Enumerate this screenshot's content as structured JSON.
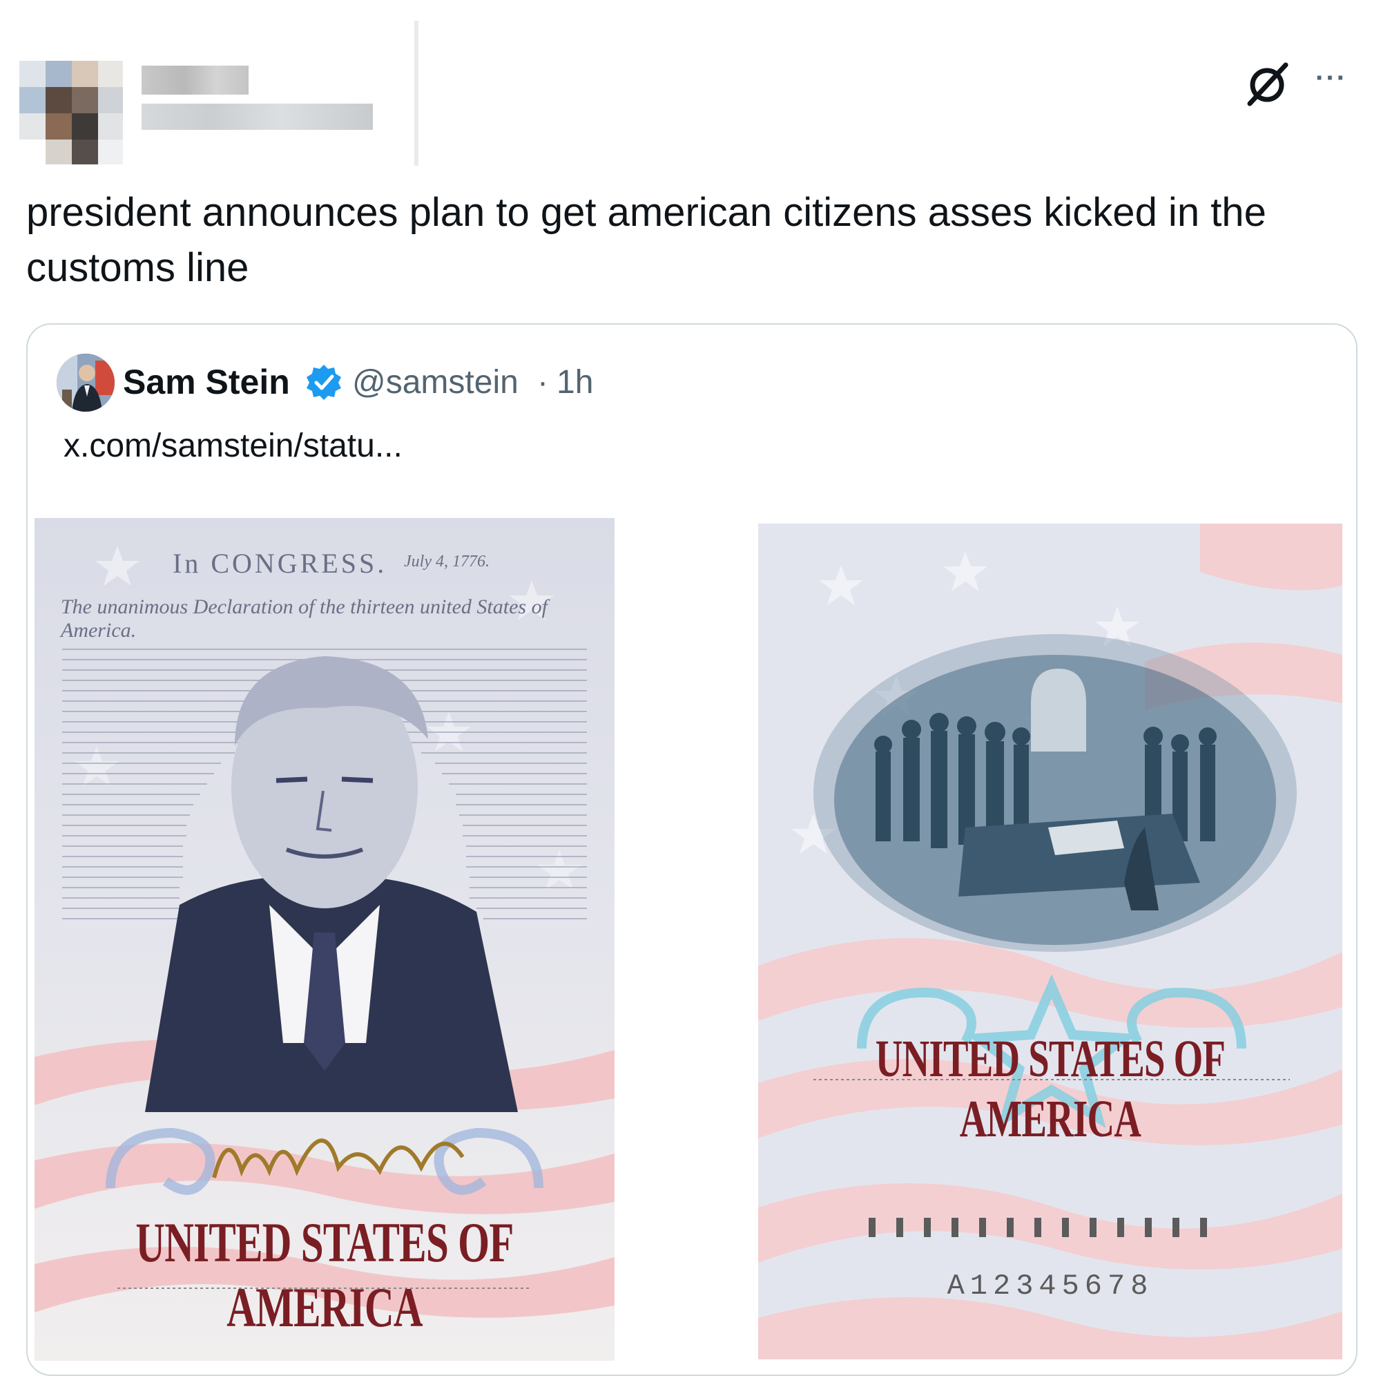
{
  "tweet": {
    "text": "president announces plan to get american citizens asses kicked in the customs line",
    "more_icon": "more-options-icon",
    "grok_icon": "grok-icon"
  },
  "quoted_tweet": {
    "author_name": "Sam Stein",
    "handle": "@samstein",
    "separator": "·",
    "time": "1h",
    "link": "x.com/samstein/statu...",
    "verified_color": "#1d9bf0",
    "images": {
      "left": {
        "congress": "In CONGRESS.",
        "congress_date": "July 4, 1776.",
        "declaration": "The unanimous Declaration of the thirteen united States of America.",
        "title": "UNITED STATES OF AMERICA"
      },
      "right": {
        "title": "UNITED STATES OF AMERICA",
        "passport_number": "A12345678"
      }
    }
  }
}
